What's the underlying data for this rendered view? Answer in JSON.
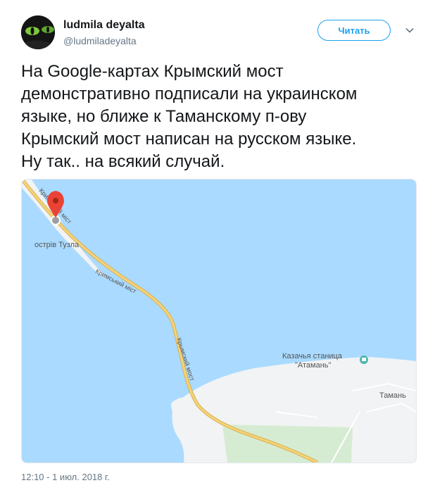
{
  "user": {
    "name": "ludmila deyalta",
    "handle": "@ludmiladeyalta",
    "follow_label": "Читать"
  },
  "tweet": {
    "lines": [
      "На Google-картах Крымский мост",
      "демонстративно подписали на украинском",
      "языке, но ближе к Таманскому п-ову",
      "Крымский мост написан на русском языке.",
      "Ну так.. на всякий случай."
    ]
  },
  "map": {
    "labels": {
      "island": "острів Тузла",
      "bridge_top": "Кримський міст",
      "bridge_mid": "Кримський міст",
      "bridge_low": "Крымский мост",
      "poi_line1": "Казачья станица",
      "poi_line2": "\"Атамань\"",
      "town": "Тамань"
    },
    "colors": {
      "water": "#aadaff",
      "land": "#f1f3f4",
      "green": "#d6ecd2",
      "road": "#f5d37a",
      "road_edge": "#d8b04c",
      "pin": "#ea4335"
    },
    "icons": [
      "map-pin-icon",
      "museum-poi-icon"
    ]
  },
  "footer": {
    "timestamp": "12:10 - 1 июл. 2018 г."
  }
}
